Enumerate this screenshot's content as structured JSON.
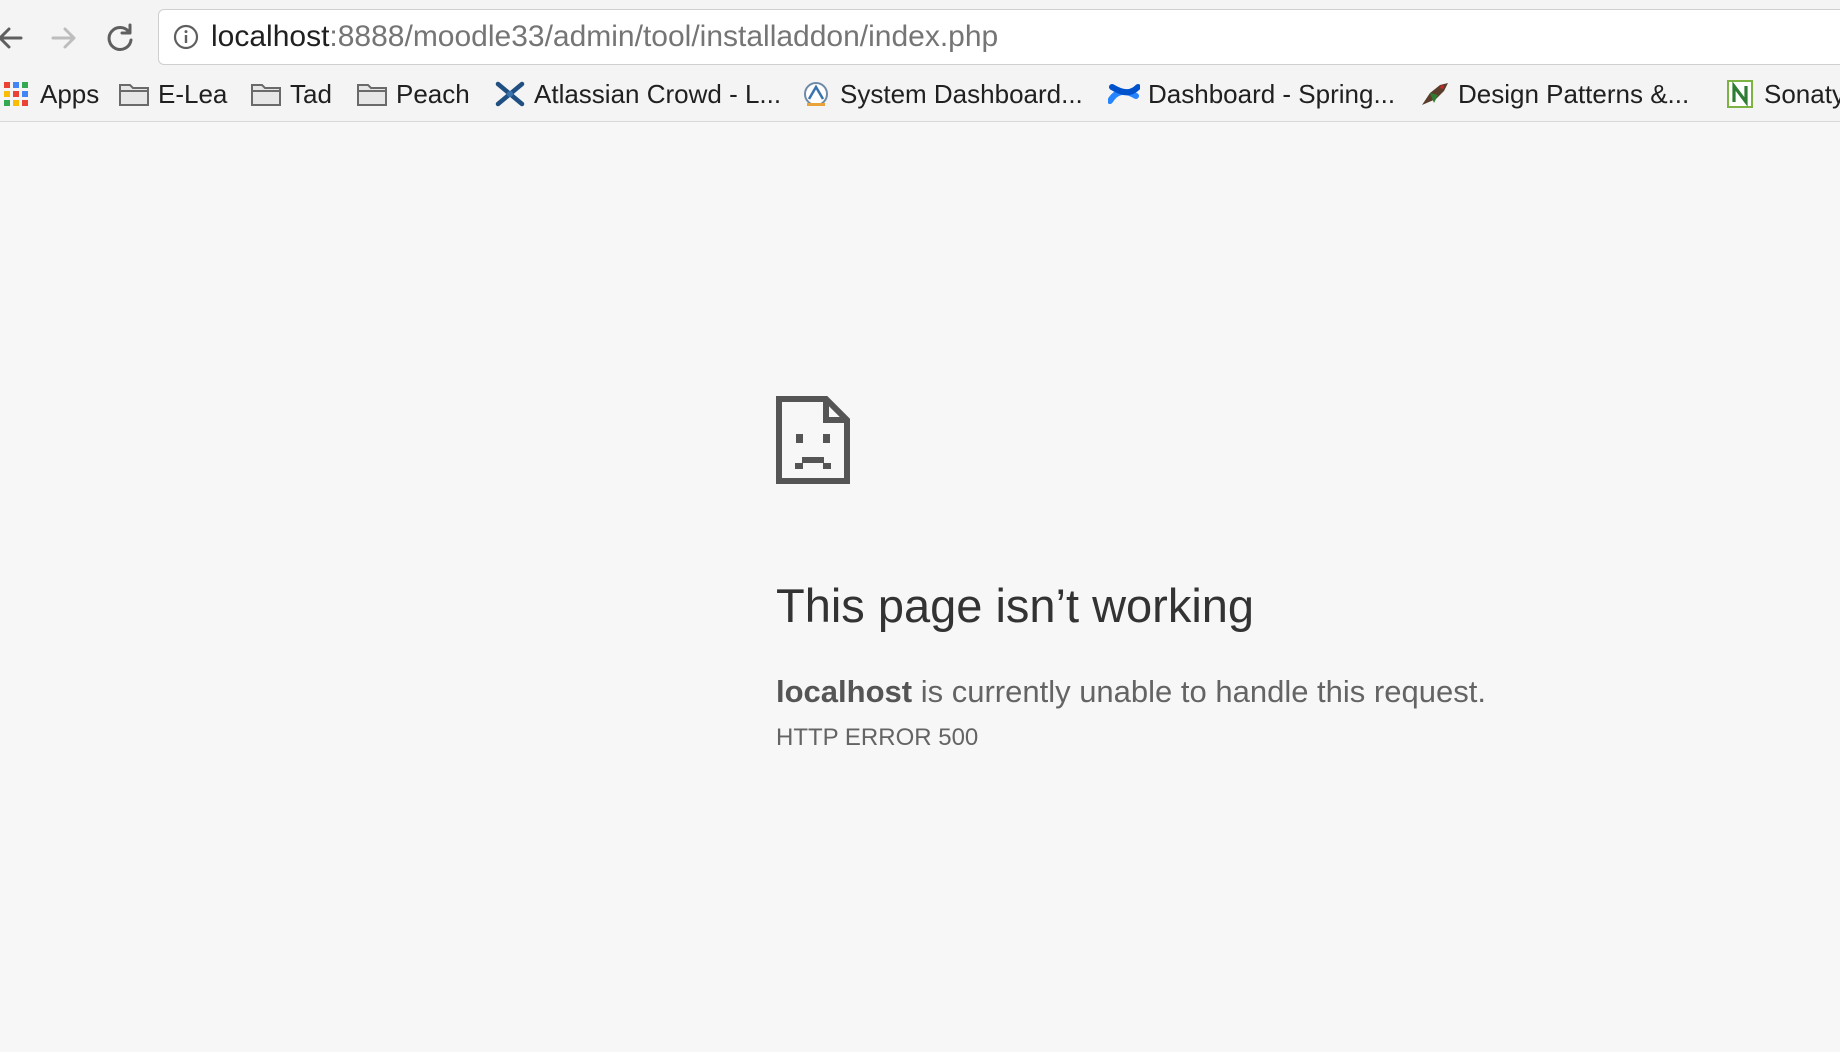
{
  "browser": {
    "url": {
      "host": "localhost",
      "rest": ":8888/moodle33/admin/tool/installaddon/index.php"
    },
    "bookmarks": [
      {
        "label": "Apps",
        "icon": "apps-grid-icon"
      },
      {
        "label": "E-Lea",
        "icon": "folder-icon"
      },
      {
        "label": "Tad",
        "icon": "folder-icon"
      },
      {
        "label": "Peach",
        "icon": "folder-icon"
      },
      {
        "label": "Atlassian Crowd - L...",
        "icon": "atlassian-crowd-icon"
      },
      {
        "label": "System Dashboard...",
        "icon": "jira-icon"
      },
      {
        "label": "Dashboard - Spring...",
        "icon": "confluence-icon"
      },
      {
        "label": "Design Patterns &...",
        "icon": "bird-icon"
      },
      {
        "label": "Sonaty",
        "icon": "nexus-icon"
      }
    ]
  },
  "error_page": {
    "icon": "sad-page-icon",
    "headline": "This page isn’t working",
    "message_host": "localhost",
    "message_rest": " is currently unable to handle this request.",
    "error_code": "HTTP ERROR 500"
  },
  "colors": {
    "background": "#f7f7f7",
    "headline": "#333333",
    "body_text": "#646464"
  }
}
